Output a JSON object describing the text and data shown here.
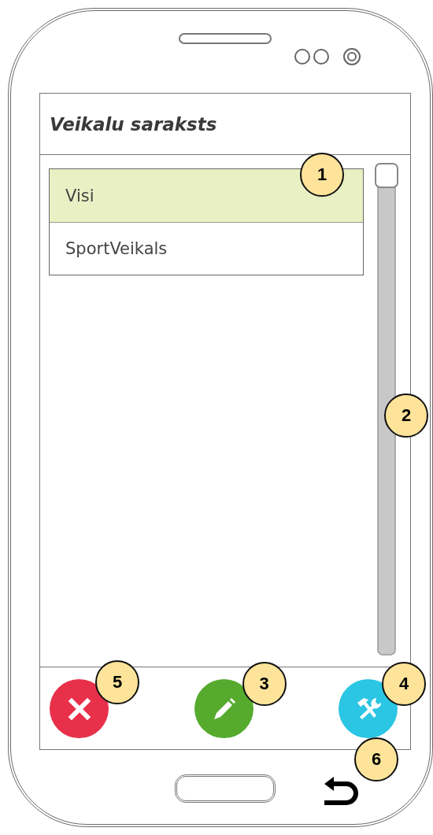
{
  "screen": {
    "title": "Veikalu saraksts",
    "list": {
      "callout": "1",
      "items": [
        {
          "label": "Visi",
          "selected": true
        },
        {
          "label": "SportVeikals",
          "selected": false
        }
      ]
    },
    "scrollbar": {
      "callout": "2"
    },
    "actions": [
      {
        "kind": "delete",
        "callout": "5"
      },
      {
        "kind": "edit",
        "callout": "3"
      },
      {
        "kind": "tools",
        "callout": "4"
      }
    ]
  },
  "device": {
    "back_button": {
      "callout": "6"
    }
  }
}
